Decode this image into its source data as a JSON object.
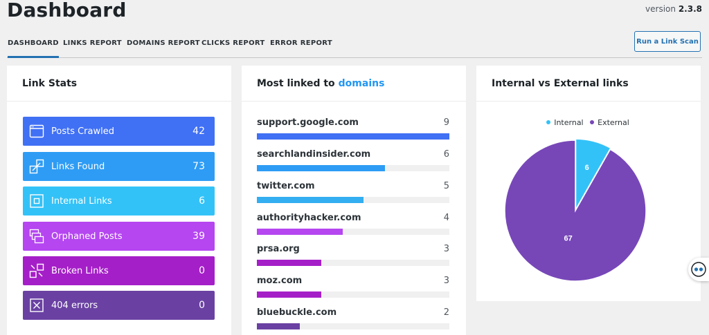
{
  "header": {
    "title": "Dashboard",
    "version_prefix": "version",
    "version_number": "2.3.8"
  },
  "tabs": [
    {
      "label": "DASHBOARD"
    },
    {
      "label": "LINKS REPORT"
    },
    {
      "label": "DOMAINS REPORT"
    },
    {
      "label": "CLICKS REPORT"
    },
    {
      "label": "ERROR REPORT"
    }
  ],
  "scan_button": "Run a Link Scan",
  "link_stats": {
    "title": "Link Stats",
    "items": [
      {
        "label": "Posts Crawled",
        "value": "42",
        "color": "#4070f4",
        "icon": "window-icon"
      },
      {
        "label": "Links Found",
        "value": "73",
        "color": "#2e9cf4",
        "icon": "link-squares-icon"
      },
      {
        "label": "Internal Links",
        "value": "6",
        "color": "#33c2f7",
        "icon": "square-in-square-icon"
      },
      {
        "label": "Orphaned Posts",
        "value": "39",
        "color": "#b546f0",
        "icon": "stacked-windows-icon"
      },
      {
        "label": "Broken Links",
        "value": "0",
        "color": "#a51fc8",
        "icon": "broken-link-icon"
      },
      {
        "label": "404 errors",
        "value": "0",
        "color": "#6a41a3",
        "icon": "x-box-icon"
      }
    ]
  },
  "domains": {
    "title_prefix": "Most linked to",
    "title_link": "domains",
    "max": 9,
    "items": [
      {
        "name": "support.google.com",
        "count": 9,
        "color": "#4070f4"
      },
      {
        "name": "searchlandinsider.com",
        "count": 6,
        "color": "#2e9cf4"
      },
      {
        "name": "twitter.com",
        "count": 5,
        "color": "#33aef0"
      },
      {
        "name": "authorityhacker.com",
        "count": 4,
        "color": "#b546f0"
      },
      {
        "name": "prsa.org",
        "count": 3,
        "color": "#a51fc8"
      },
      {
        "name": "moz.com",
        "count": 3,
        "color": "#a51fc8"
      },
      {
        "name": "bluebuckle.com",
        "count": 2,
        "color": "#6a41a3"
      }
    ]
  },
  "chart_data": {
    "type": "pie",
    "title": "Internal vs External links",
    "legend": "top",
    "series": [
      {
        "name": "Internal",
        "value": 6,
        "color": "#33c2f7"
      },
      {
        "name": "External",
        "value": 67,
        "color": "#7747b8"
      }
    ]
  }
}
